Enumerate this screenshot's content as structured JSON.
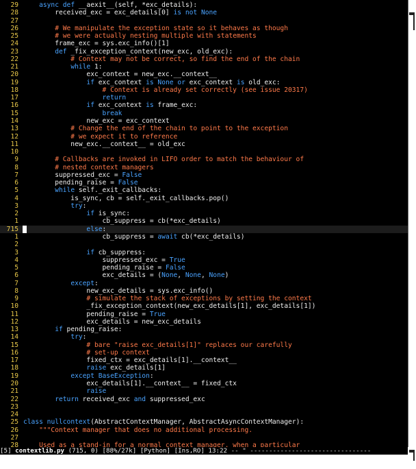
{
  "editor": {
    "lines": [
      {
        "n": "29",
        "segs": [
          {
            "c": "pl",
            "t": "    "
          },
          {
            "c": "kw",
            "t": "async"
          },
          {
            "c": "pl",
            "t": " "
          },
          {
            "c": "kw",
            "t": "def"
          },
          {
            "c": "pl",
            "t": " __aexit__(self, *exc_details):"
          }
        ]
      },
      {
        "n": "28",
        "segs": [
          {
            "c": "pl",
            "t": "        received_exc = exc_details[0] "
          },
          {
            "c": "kw",
            "t": "is"
          },
          {
            "c": "pl",
            "t": " "
          },
          {
            "c": "kw",
            "t": "not"
          },
          {
            "c": "pl",
            "t": " "
          },
          {
            "c": "kw",
            "t": "None"
          }
        ]
      },
      {
        "n": "27",
        "segs": []
      },
      {
        "n": "26",
        "segs": [
          {
            "c": "cm",
            "t": "        # We manipulate the exception state so it behaves as though"
          }
        ]
      },
      {
        "n": "25",
        "segs": [
          {
            "c": "cm",
            "t": "        # we were actually nesting multiple with statements"
          }
        ]
      },
      {
        "n": "24",
        "segs": [
          {
            "c": "pl",
            "t": "        frame_exc = sys.exc_info()[1]"
          }
        ]
      },
      {
        "n": "23",
        "segs": [
          {
            "c": "pl",
            "t": "        "
          },
          {
            "c": "kw",
            "t": "def"
          },
          {
            "c": "pl",
            "t": " _fix_exception_context(new_exc, old_exc):"
          }
        ]
      },
      {
        "n": "22",
        "segs": [
          {
            "c": "cm",
            "t": "            # Context may not be correct, so find the end of the chain"
          }
        ]
      },
      {
        "n": "21",
        "segs": [
          {
            "c": "pl",
            "t": "            "
          },
          {
            "c": "kw",
            "t": "while"
          },
          {
            "c": "pl",
            "t": " 1:"
          }
        ]
      },
      {
        "n": "20",
        "segs": [
          {
            "c": "pl",
            "t": "                exc_context = new_exc.__context__"
          }
        ]
      },
      {
        "n": "19",
        "segs": [
          {
            "c": "pl",
            "t": "                "
          },
          {
            "c": "kw",
            "t": "if"
          },
          {
            "c": "pl",
            "t": " exc_context "
          },
          {
            "c": "kw",
            "t": "is"
          },
          {
            "c": "pl",
            "t": " "
          },
          {
            "c": "kw",
            "t": "None"
          },
          {
            "c": "pl",
            "t": " "
          },
          {
            "c": "kw",
            "t": "or"
          },
          {
            "c": "pl",
            "t": " exc_context "
          },
          {
            "c": "kw",
            "t": "is"
          },
          {
            "c": "pl",
            "t": " old_exc:"
          }
        ]
      },
      {
        "n": "18",
        "segs": [
          {
            "c": "cm",
            "t": "                    # Context is already set correctly (see issue 20317)"
          }
        ]
      },
      {
        "n": "17",
        "segs": [
          {
            "c": "pl",
            "t": "                    "
          },
          {
            "c": "kw",
            "t": "return"
          }
        ]
      },
      {
        "n": "16",
        "segs": [
          {
            "c": "pl",
            "t": "                "
          },
          {
            "c": "kw",
            "t": "if"
          },
          {
            "c": "pl",
            "t": " exc_context "
          },
          {
            "c": "kw",
            "t": "is"
          },
          {
            "c": "pl",
            "t": " frame_exc:"
          }
        ]
      },
      {
        "n": "15",
        "segs": [
          {
            "c": "pl",
            "t": "                    "
          },
          {
            "c": "kw",
            "t": "break"
          }
        ]
      },
      {
        "n": "14",
        "segs": [
          {
            "c": "pl",
            "t": "                new_exc = exc_context"
          }
        ]
      },
      {
        "n": "13",
        "segs": [
          {
            "c": "cm",
            "t": "            # Change the end of the chain to point to the exception"
          }
        ]
      },
      {
        "n": "12",
        "segs": [
          {
            "c": "cm",
            "t": "            # we expect it to reference"
          }
        ]
      },
      {
        "n": "11",
        "segs": [
          {
            "c": "pl",
            "t": "            new_exc.__context__ = old_exc"
          }
        ]
      },
      {
        "n": "10",
        "segs": []
      },
      {
        "n": "9",
        "segs": [
          {
            "c": "cm",
            "t": "        # Callbacks are invoked in LIFO order to match the behaviour of"
          }
        ]
      },
      {
        "n": "8",
        "segs": [
          {
            "c": "cm",
            "t": "        # nested context managers"
          }
        ]
      },
      {
        "n": "7",
        "segs": [
          {
            "c": "pl",
            "t": "        suppressed_exc = "
          },
          {
            "c": "kw",
            "t": "False"
          }
        ]
      },
      {
        "n": "6",
        "segs": [
          {
            "c": "pl",
            "t": "        pending_raise = "
          },
          {
            "c": "kw",
            "t": "False"
          }
        ]
      },
      {
        "n": "5",
        "segs": [
          {
            "c": "pl",
            "t": "        "
          },
          {
            "c": "kw",
            "t": "while"
          },
          {
            "c": "pl",
            "t": " self._exit_callbacks:"
          }
        ]
      },
      {
        "n": "4",
        "segs": [
          {
            "c": "pl",
            "t": "            is_sync, cb = self._exit_callbacks.pop()"
          }
        ]
      },
      {
        "n": "3",
        "segs": [
          {
            "c": "pl",
            "t": "            "
          },
          {
            "c": "kw",
            "t": "try"
          },
          {
            "c": "pl",
            "t": ":"
          }
        ]
      },
      {
        "n": "2",
        "segs": [
          {
            "c": "pl",
            "t": "                "
          },
          {
            "c": "kw",
            "t": "if"
          },
          {
            "c": "pl",
            "t": " is_sync:"
          }
        ]
      },
      {
        "n": "1",
        "segs": [
          {
            "c": "pl",
            "t": "                    cb_suppress = cb(*exc_details)"
          }
        ]
      },
      {
        "n": "715",
        "cur": true,
        "segs": [
          {
            "c": "pl",
            "t": "                "
          },
          {
            "c": "kw",
            "t": "else"
          },
          {
            "c": "pl",
            "t": ":"
          }
        ]
      },
      {
        "n": "1",
        "segs": [
          {
            "c": "pl",
            "t": "                    cb_suppress = "
          },
          {
            "c": "kw",
            "t": "await"
          },
          {
            "c": "pl",
            "t": " cb(*exc_details)"
          }
        ]
      },
      {
        "n": "2",
        "segs": []
      },
      {
        "n": "3",
        "segs": [
          {
            "c": "pl",
            "t": "                "
          },
          {
            "c": "kw",
            "t": "if"
          },
          {
            "c": "pl",
            "t": " cb_suppress:"
          }
        ]
      },
      {
        "n": "4",
        "segs": [
          {
            "c": "pl",
            "t": "                    suppressed_exc = "
          },
          {
            "c": "kw",
            "t": "True"
          }
        ]
      },
      {
        "n": "5",
        "segs": [
          {
            "c": "pl",
            "t": "                    pending_raise = "
          },
          {
            "c": "kw",
            "t": "False"
          }
        ]
      },
      {
        "n": "6",
        "segs": [
          {
            "c": "pl",
            "t": "                    exc_details = ("
          },
          {
            "c": "kw",
            "t": "None"
          },
          {
            "c": "pl",
            "t": ", "
          },
          {
            "c": "kw",
            "t": "None"
          },
          {
            "c": "pl",
            "t": ", "
          },
          {
            "c": "kw",
            "t": "None"
          },
          {
            "c": "pl",
            "t": ")"
          }
        ]
      },
      {
        "n": "7",
        "segs": [
          {
            "c": "pl",
            "t": "            "
          },
          {
            "c": "kw",
            "t": "except"
          },
          {
            "c": "pl",
            "t": ":"
          }
        ]
      },
      {
        "n": "8",
        "segs": [
          {
            "c": "pl",
            "t": "                new_exc_details = sys.exc_info()"
          }
        ]
      },
      {
        "n": "9",
        "segs": [
          {
            "c": "cm",
            "t": "                # simulate the stack of exceptions by setting the context"
          }
        ]
      },
      {
        "n": "10",
        "segs": [
          {
            "c": "pl",
            "t": "                _fix_exception_context(new_exc_details[1], exc_details[1])"
          }
        ]
      },
      {
        "n": "11",
        "segs": [
          {
            "c": "pl",
            "t": "                pending_raise = "
          },
          {
            "c": "kw",
            "t": "True"
          }
        ]
      },
      {
        "n": "12",
        "segs": [
          {
            "c": "pl",
            "t": "                exc_details = new_exc_details"
          }
        ]
      },
      {
        "n": "13",
        "segs": [
          {
            "c": "pl",
            "t": "        "
          },
          {
            "c": "kw",
            "t": "if"
          },
          {
            "c": "pl",
            "t": " pending_raise:"
          }
        ]
      },
      {
        "n": "14",
        "segs": [
          {
            "c": "pl",
            "t": "            "
          },
          {
            "c": "kw",
            "t": "try"
          },
          {
            "c": "pl",
            "t": ":"
          }
        ]
      },
      {
        "n": "15",
        "segs": [
          {
            "c": "cm",
            "t": "                # bare \"raise exc_details[1]\" replaces our carefully"
          }
        ]
      },
      {
        "n": "16",
        "segs": [
          {
            "c": "cm",
            "t": "                # set-up context"
          }
        ]
      },
      {
        "n": "17",
        "segs": [
          {
            "c": "pl",
            "t": "                fixed_ctx = exc_details[1].__context__"
          }
        ]
      },
      {
        "n": "18",
        "segs": [
          {
            "c": "pl",
            "t": "                "
          },
          {
            "c": "kw",
            "t": "raise"
          },
          {
            "c": "pl",
            "t": " exc_details[1]"
          }
        ]
      },
      {
        "n": "19",
        "segs": [
          {
            "c": "pl",
            "t": "            "
          },
          {
            "c": "kw",
            "t": "except"
          },
          {
            "c": "pl",
            "t": " "
          },
          {
            "c": "kw",
            "t": "BaseException"
          },
          {
            "c": "pl",
            "t": ":"
          }
        ]
      },
      {
        "n": "20",
        "segs": [
          {
            "c": "pl",
            "t": "                exc_details[1].__context__ = fixed_ctx"
          }
        ]
      },
      {
        "n": "21",
        "segs": [
          {
            "c": "pl",
            "t": "                "
          },
          {
            "c": "kw",
            "t": "raise"
          }
        ]
      },
      {
        "n": "22",
        "segs": [
          {
            "c": "pl",
            "t": "        "
          },
          {
            "c": "kw",
            "t": "return"
          },
          {
            "c": "pl",
            "t": " received_exc "
          },
          {
            "c": "kw",
            "t": "and"
          },
          {
            "c": "pl",
            "t": " suppressed_exc"
          }
        ]
      },
      {
        "n": "23",
        "segs": []
      },
      {
        "n": "24",
        "segs": []
      },
      {
        "n": "25",
        "segs": [
          {
            "c": "kw",
            "t": "class"
          },
          {
            "c": "pl",
            "t": " "
          },
          {
            "c": "kw",
            "t": "nullcontext"
          },
          {
            "c": "pl",
            "t": "(AbstractContextManager, AbstractAsyncContextManager):"
          }
        ]
      },
      {
        "n": "26",
        "segs": [
          {
            "c": "st",
            "t": "    \"\"\"Context manager that does no additional processing."
          }
        ]
      },
      {
        "n": "27",
        "segs": []
      },
      {
        "n": "28",
        "segs": [
          {
            "c": "st",
            "t": "    Used as a stand-in for a normal context manager, when a particular"
          }
        ]
      }
    ]
  },
  "status": {
    "buffer": "[5]",
    "file": "contextlib.py",
    "position": "(715, 0)",
    "percent": "[88%/27k]",
    "mode": "[Python]",
    "state": "[Ins,RO]",
    "time": "13:22",
    "tail": "-- \" --------------------------------"
  },
  "colors": {
    "background": "#000000",
    "keyword": "#4aa3ff",
    "comment": "#ff7a4a",
    "line_number": "#e8c84a",
    "text": "#f0f0f0"
  }
}
